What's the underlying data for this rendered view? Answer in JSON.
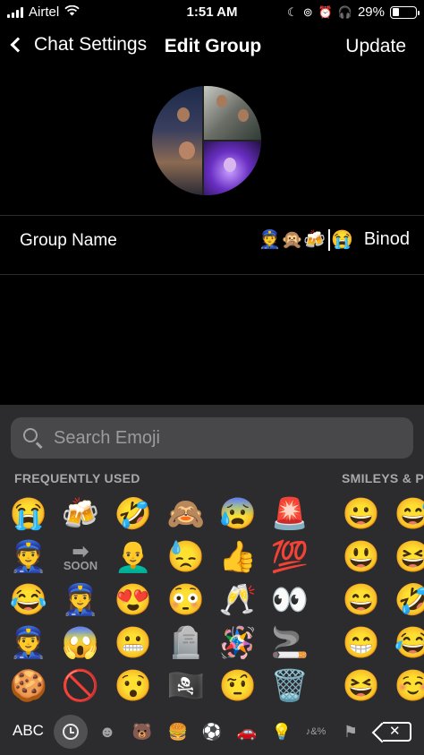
{
  "status_bar": {
    "carrier": "Airtel",
    "time": "1:51 AM",
    "battery_percent": "29%",
    "battery_level": 0.29
  },
  "nav": {
    "back_label": "Chat Settings",
    "title": "Edit Group",
    "update_label": "Update"
  },
  "group": {
    "name_label": "Group Name",
    "name_emojis_before_cursor": "👮🙊🍻",
    "name_emojis_after_cursor": "😭",
    "name_text": "Binod"
  },
  "keyboard": {
    "search_placeholder": "Search Emoji",
    "section_frequent": "FREQUENTLY USED",
    "section_smileys": "SMILEYS & P",
    "frequent_emojis": [
      [
        "😭",
        "🍻",
        "🤣",
        "🙈",
        "😰",
        "🚨"
      ],
      [
        "👮",
        "SOON",
        "👨‍🦲",
        "😓",
        "👍",
        "💯"
      ],
      [
        "😂",
        "👮‍♀️",
        "😍",
        "😳",
        "🥂",
        "👀"
      ],
      [
        "👮",
        "😱",
        "😬",
        "🪦",
        "🪅",
        "🚬"
      ],
      [
        "🍪",
        "🚫",
        "😯",
        "🏴‍☠️",
        "🤨",
        "🗑️"
      ]
    ],
    "soon_label": "SOON",
    "smiley_emojis": [
      [
        "😀",
        "😅"
      ],
      [
        "😃",
        "😆"
      ],
      [
        "😄",
        "🤣"
      ],
      [
        "😁",
        "😂"
      ],
      [
        "😆",
        "☺️"
      ]
    ],
    "abc_label": "ABC",
    "categories": [
      "clock-icon",
      "smiley-icon",
      "bear-icon",
      "food-icon",
      "ball-icon",
      "car-icon",
      "bulb-icon",
      "symbols-icon",
      "flag-icon"
    ],
    "category_glyphs": [
      "",
      "☻",
      "🐻",
      "🍔",
      "⚽",
      "🚗",
      "💡",
      "♪&%",
      "⚑"
    ]
  }
}
